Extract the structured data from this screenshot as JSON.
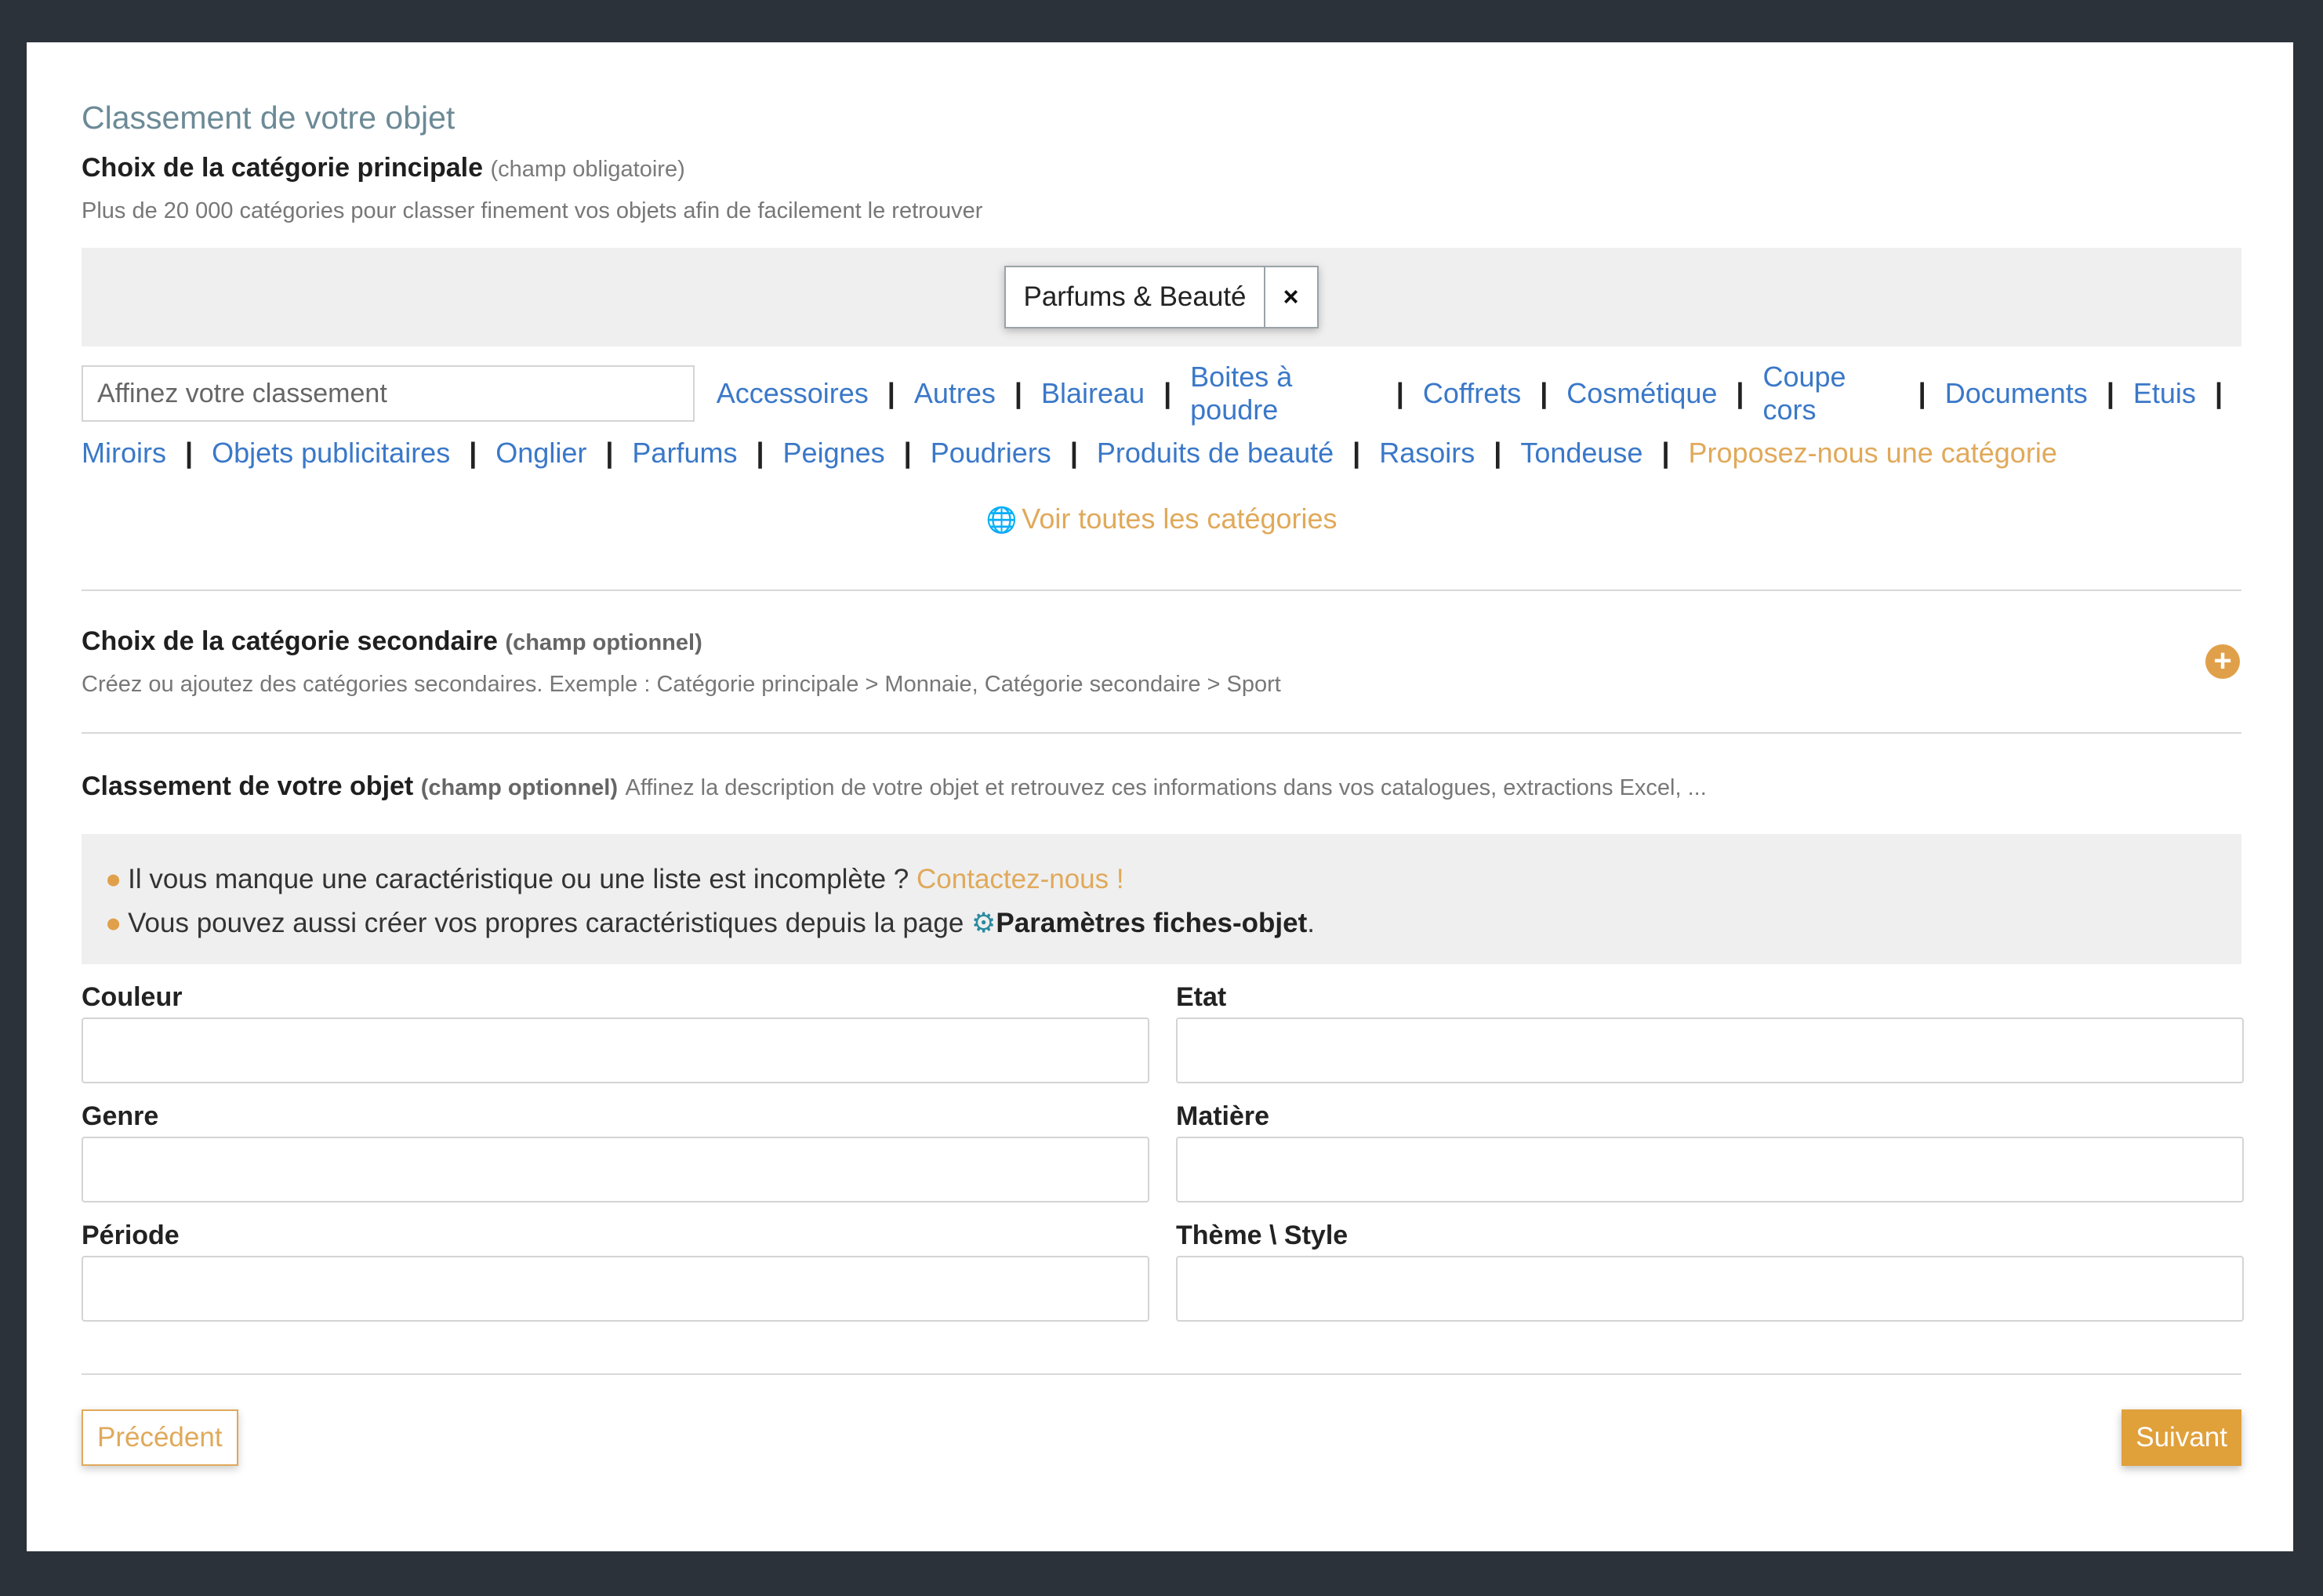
{
  "section_title": "Classement de votre objet",
  "primary": {
    "title": "Choix de la catégorie principale",
    "note": "(champ obligatoire)",
    "help": "Plus de 20 000 catégories pour classer finement vos objets afin de facilement le retrouver",
    "selected_tag": "Parfums & Beauté",
    "close_symbol": "×",
    "refine_placeholder": "Affinez votre classement",
    "categories_line1": [
      "Accessoires",
      "Autres",
      "Blaireau",
      "Boites à poudre",
      "Coffrets",
      "Cosmétique",
      "Coupe cors",
      "Documents",
      "Etuis"
    ],
    "categories_line2": [
      "Miroirs",
      "Objets publicitaires",
      "Onglier",
      "Parfums",
      "Peignes",
      "Poudriers",
      "Produits de beauté",
      "Rasoirs",
      "Tondeuse"
    ],
    "separator": "|",
    "propose_link": "Proposez-nous une catégorie",
    "see_all": "Voir toutes les catégories"
  },
  "secondary": {
    "title": "Choix de la catégorie secondaire",
    "note": "(champ optionnel)",
    "help": "Créez ou ajoutez des catégories secondaires. Exemple : Catégorie principale > Monnaie, Catégorie secondaire > Sport"
  },
  "classement": {
    "title": "Classement de votre objet",
    "note": "(champ optionnel)",
    "help": "Affinez la description de votre objet et retrouvez ces informations dans vos catalogues, extractions Excel, ..."
  },
  "info": {
    "line1_text": "Il vous manque une caractéristique ou une liste est incomplète ?",
    "line1_link": "Contactez-nous !",
    "line2_text": "Vous pouvez aussi créer vos propres caractéristiques depuis la page",
    "line2_bold": "Paramètres fiches-objet",
    "line2_end": "."
  },
  "fields": {
    "couleur": "Couleur",
    "etat": "Etat",
    "genre": "Genre",
    "matiere": "Matière",
    "periode": "Période",
    "theme": "Thème \\ Style"
  },
  "buttons": {
    "prev": "Précédent",
    "next": "Suivant"
  },
  "colors": {
    "accent": "#e0a95a",
    "link": "#3a78c8",
    "title": "#6c8a96",
    "page_bg": "#2b323a"
  }
}
